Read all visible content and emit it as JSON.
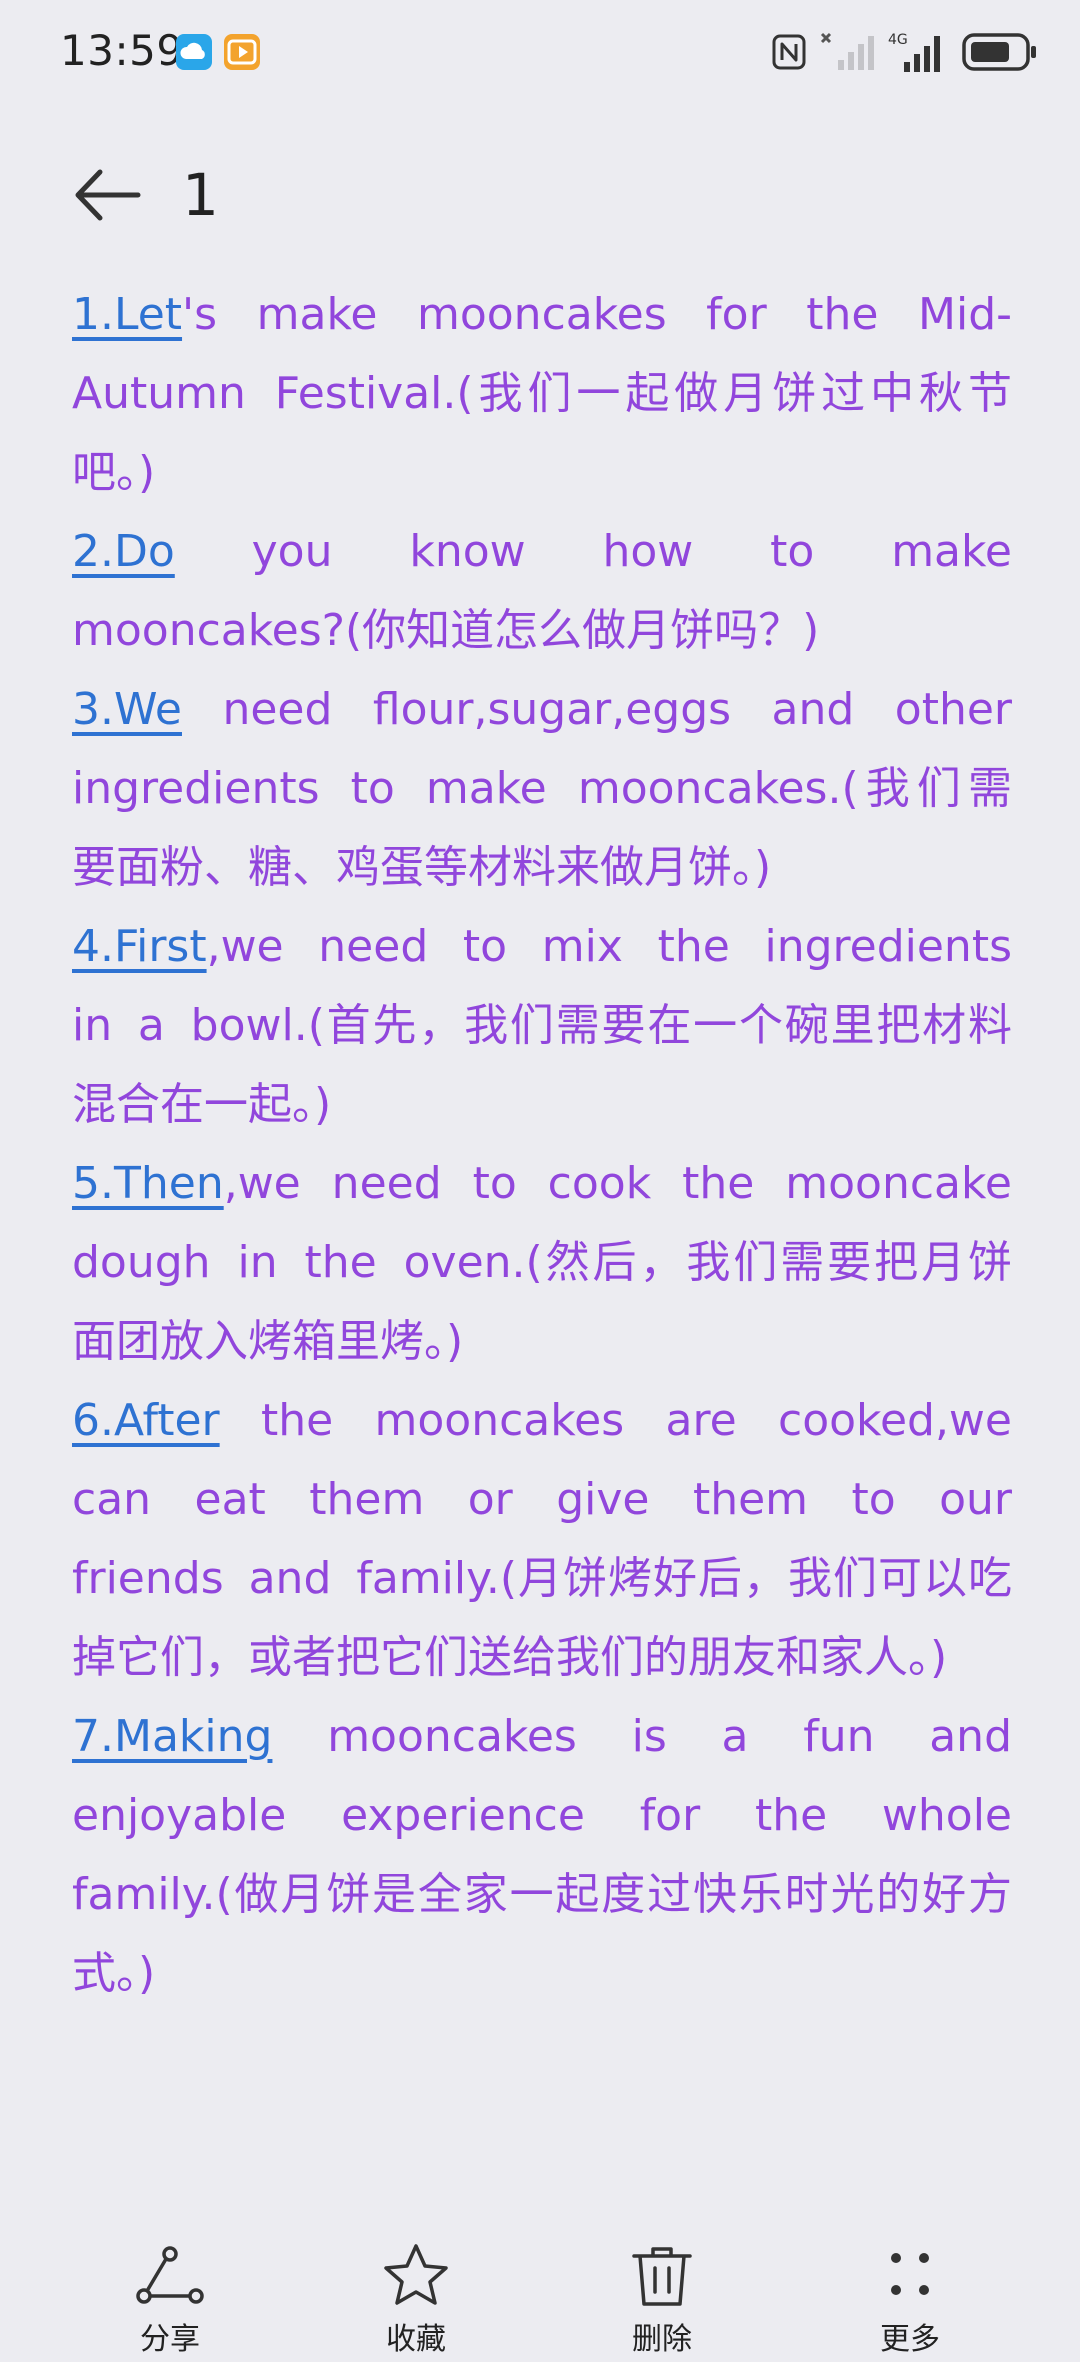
{
  "status_bar": {
    "time": "13:59",
    "network": "4G"
  },
  "header": {
    "title": "1"
  },
  "content": {
    "sentences": [
      {
        "num": "1.Let",
        "rest": "'s make mooncakes for the Mid-Autumn Festival.(我们一起做月饼过中秋节吧。)"
      },
      {
        "num": "2.Do",
        "rest": " you know how to make mooncakes?(你知道怎么做月饼吗？)"
      },
      {
        "num": "3.We",
        "rest": " need flour,sugar,eggs and other ingredients to make mooncakes.(我们需要面粉、糖、鸡蛋等材料来做月饼。)"
      },
      {
        "num": "4.First",
        "rest": ",we need to mix the ingredients in a bowl.(首先，我们需要在一个碗里把材料混合在一起。)"
      },
      {
        "num": "5.Then",
        "rest": ",we need to cook the mooncake dough in the oven.(然后，我们需要把月饼面团放入烤箱里烤。)"
      },
      {
        "num": "6.After",
        "rest": " the mooncakes are cooked,we can eat them or give them to our friends and family.(月饼烤好后，我们可以吃掉它们，或者把它们送给我们的朋友和家人。)"
      },
      {
        "num": "7.Making",
        "rest": " mooncakes is a fun and enjoyable experience for the whole family.(做月饼是全家一起度过快乐时光的好方式。)"
      }
    ]
  },
  "bottom_bar": {
    "share_label": "分享",
    "favorite_label": "收藏",
    "delete_label": "删除",
    "more_label": "更多"
  },
  "colors": {
    "background": "#ececf1",
    "text_purple": "#9146dc",
    "link_blue": "#2e72d2"
  }
}
